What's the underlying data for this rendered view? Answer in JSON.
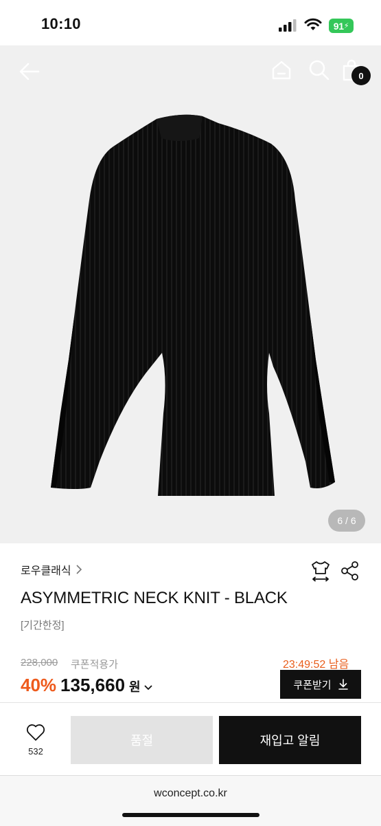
{
  "status_bar": {
    "time": "10:10",
    "battery": "91"
  },
  "header": {
    "cart_count": "0"
  },
  "gallery": {
    "page_indicator": "6 / 6"
  },
  "product": {
    "brand": "로우클래식",
    "name": "ASYMMETRIC NECK KNIT - BLACK",
    "tag": "[기간한정]",
    "original_price": "228,000",
    "coupon_price_label": "쿠폰적용가",
    "timer": "23:49:52 남음",
    "discount": "40%",
    "sale_price": "135,660",
    "currency": "원",
    "coupon_button": "쿠폰받기"
  },
  "bottom_bar": {
    "wish_count": "532",
    "soldout_label": "품절",
    "restock_label": "재입고 알림"
  },
  "browser": {
    "url": "wconcept.co.kr"
  },
  "colors": {
    "accent": "#ee5a1c",
    "timer": "#e85d1b",
    "battery": "#34c759",
    "dark": "#111111"
  }
}
